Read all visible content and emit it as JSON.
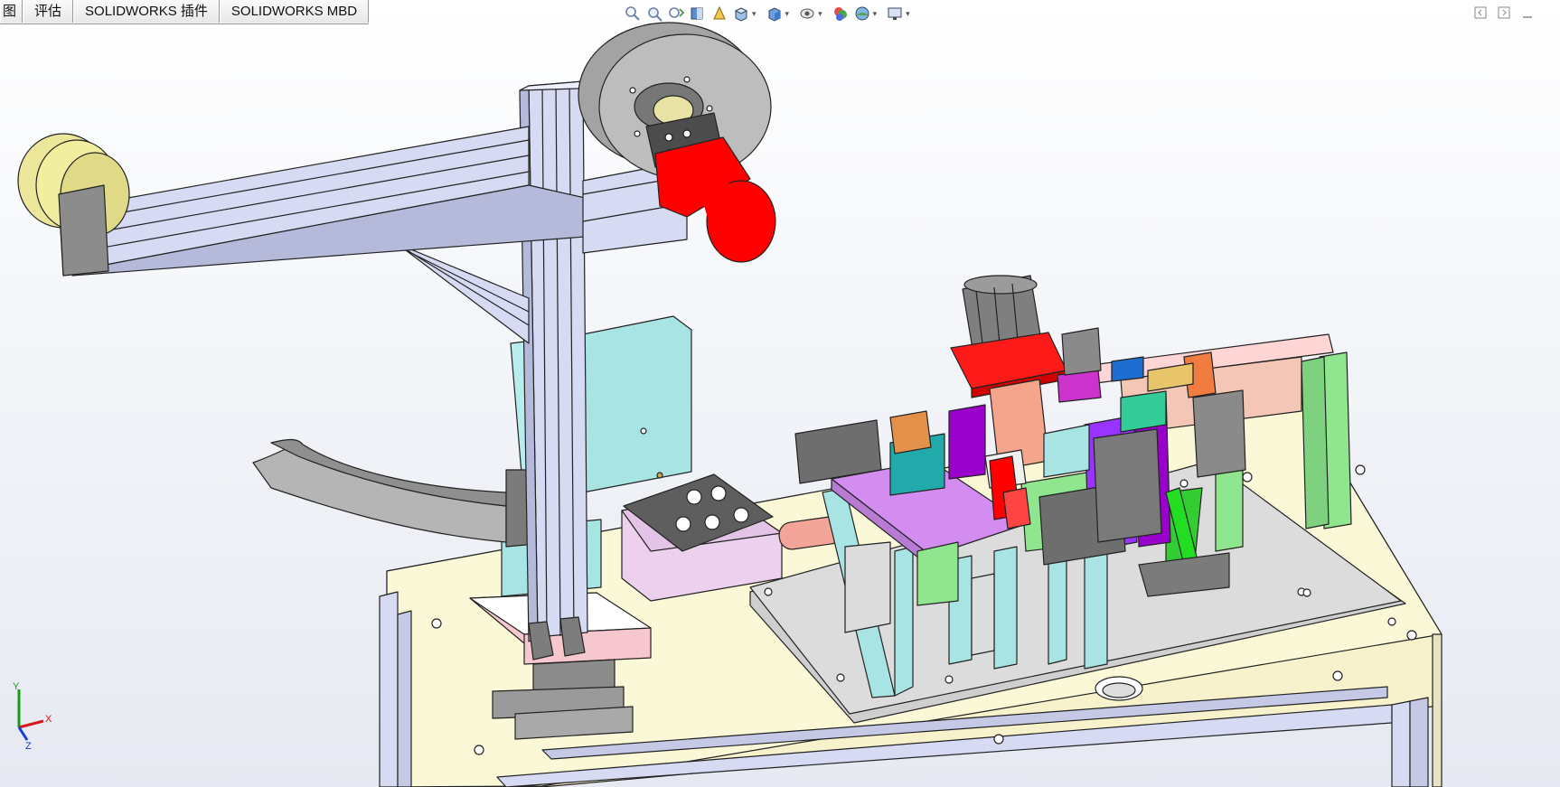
{
  "tabs": [
    {
      "label": "图"
    },
    {
      "label": "评估"
    },
    {
      "label": "SOLIDWORKS 插件"
    },
    {
      "label": "SOLIDWORKS MBD"
    }
  ],
  "headsup_toolbar": [
    {
      "icon": "zoom-to-fit-icon"
    },
    {
      "icon": "zoom-to-area-icon"
    },
    {
      "icon": "previous-view-icon"
    },
    {
      "icon": "section-view-icon"
    },
    {
      "icon": "dynamic-annotation-icon"
    },
    {
      "icon": "view-orientation-icon",
      "dropdown": true
    },
    {
      "icon": "display-style-icon",
      "dropdown": true
    },
    {
      "icon": "hide-show-items-icon",
      "dropdown": true
    },
    {
      "icon": "edit-appearance-icon"
    },
    {
      "icon": "apply-scene-icon",
      "dropdown": true
    },
    {
      "icon": "view-settings-icon",
      "dropdown": true
    }
  ],
  "window_controls": [
    {
      "icon": "tile-left-icon"
    },
    {
      "icon": "tile-right-icon"
    },
    {
      "icon": "minimize-icon"
    }
  ],
  "triad": {
    "x": "X",
    "y": "Y",
    "z": "Z"
  },
  "colors": {
    "motor_red": "#ff0000",
    "aluminum_profile": "#d6daf2",
    "cyan_plate": "#a9e4e4",
    "yellow_table": "#fbf8d8",
    "gray_plate": "#d9d9d9",
    "green_frame": "#8fe68f",
    "purple_plate": "#d38cf0",
    "pink_block": "#ecd0ee",
    "reel_yellow": "#ece79b"
  }
}
